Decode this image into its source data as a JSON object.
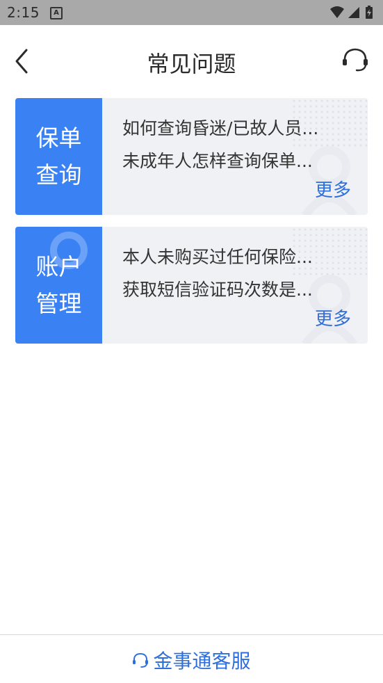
{
  "status_bar": {
    "time": "2:15",
    "notification_icon": "A",
    "icons": [
      "wifi-icon",
      "signal-icon",
      "battery-icon"
    ]
  },
  "header": {
    "title": "常见问题",
    "back_icon": "chevron-left-icon",
    "support_icon": "headset-icon"
  },
  "categories": [
    {
      "tile_label": "保单\n查询",
      "questions": [
        "如何查询昏迷/已故人员...",
        "未成年人怎样查询保单..."
      ],
      "more_label": "更多"
    },
    {
      "tile_label": "账户\n管理",
      "questions": [
        "本人未购买过任何保险...",
        "获取短信验证码次数是..."
      ],
      "more_label": "更多"
    }
  ],
  "footer": {
    "service_label": "金事通客服",
    "service_icon": "headset-icon"
  },
  "colors": {
    "accent": "#3a82f3",
    "link": "#2f6fda",
    "card_bg": "#f0f1f5",
    "status_bar": "#a9a9a9"
  }
}
